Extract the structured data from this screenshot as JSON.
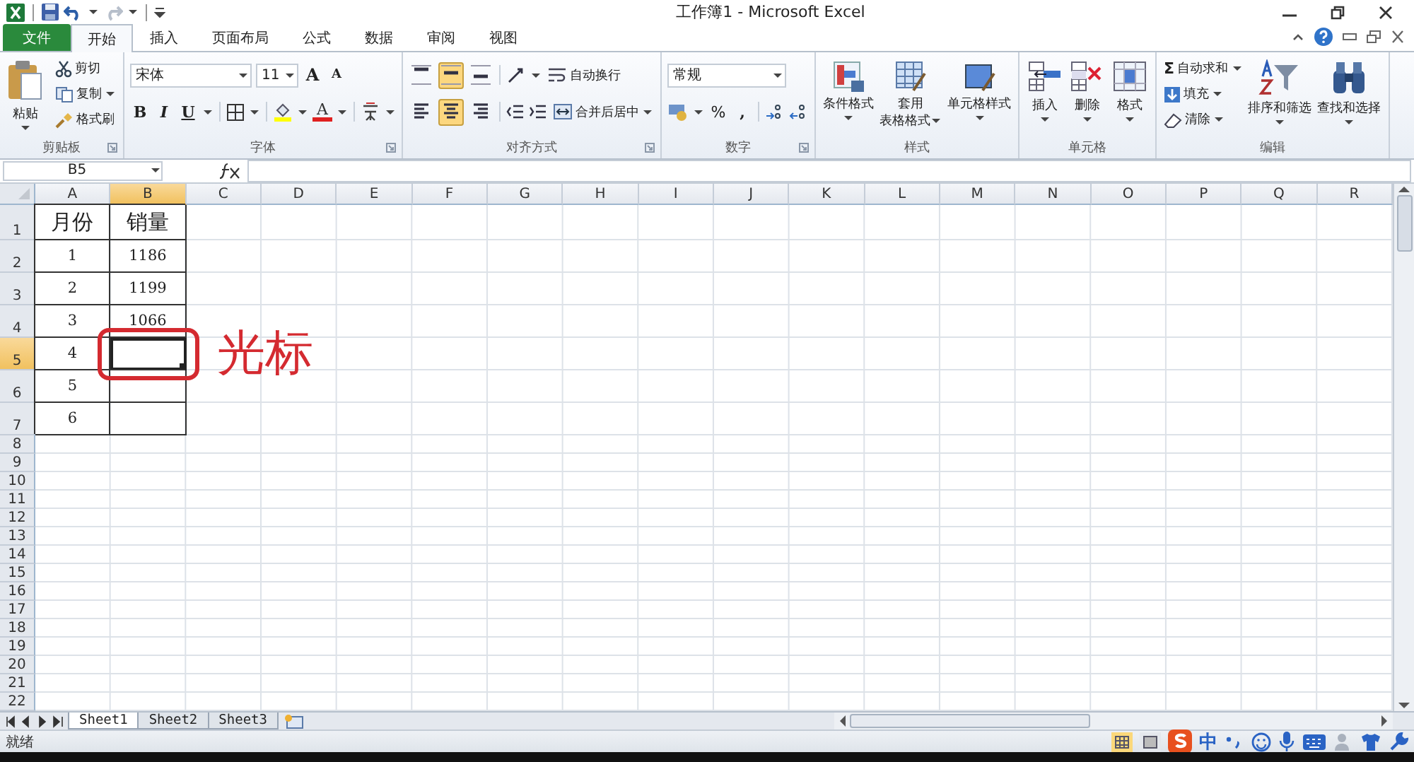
{
  "window": {
    "title": "工作簿1 - Microsoft Excel"
  },
  "ribbon_tabs": [
    {
      "label": "文件",
      "kind": "file",
      "selected": false
    },
    {
      "label": "开始",
      "kind": "tab",
      "selected": true
    },
    {
      "label": "插入",
      "kind": "tab",
      "selected": false
    },
    {
      "label": "页面布局",
      "kind": "tab",
      "selected": false
    },
    {
      "label": "公式",
      "kind": "tab",
      "selected": false
    },
    {
      "label": "数据",
      "kind": "tab",
      "selected": false
    },
    {
      "label": "审阅",
      "kind": "tab",
      "selected": false
    },
    {
      "label": "视图",
      "kind": "tab",
      "selected": false
    }
  ],
  "clipboard": {
    "title": "剪贴板",
    "paste": "粘贴",
    "cut": "剪切",
    "copy": "复制",
    "format_painter": "格式刷"
  },
  "font": {
    "title": "字体",
    "font_name": "宋体",
    "font_size": "11",
    "grow": "A",
    "shrink": "A",
    "bold": "B",
    "italic": "I",
    "underline": "U",
    "font_color": "A"
  },
  "alignment": {
    "title": "对齐方式",
    "vertical": [
      {
        "kind": "top",
        "selected": false
      },
      {
        "kind": "middle",
        "selected": true
      },
      {
        "kind": "bottom",
        "selected": false
      }
    ],
    "horizontal": [
      {
        "kind": "left",
        "selected": false
      },
      {
        "kind": "center",
        "selected": true
      },
      {
        "kind": "right",
        "selected": false
      }
    ],
    "wrap_text": "自动换行",
    "merge_center": "合并后居中"
  },
  "number": {
    "title": "数字",
    "format": "常规",
    "percent": "%",
    "comma": ","
  },
  "styles": {
    "title": "样式",
    "buttons": [
      {
        "kind": "conditional",
        "lines": [
          "条件格式"
        ]
      },
      {
        "kind": "table",
        "lines": [
          "套用",
          "表格格式"
        ]
      },
      {
        "kind": "cell",
        "lines": [
          "单元格样式"
        ]
      }
    ]
  },
  "cells": {
    "title": "单元格",
    "buttons": [
      {
        "kind": "insert",
        "label": "插入"
      },
      {
        "kind": "delete",
        "label": "删除"
      },
      {
        "kind": "format",
        "label": "格式"
      }
    ]
  },
  "editing": {
    "title": "编辑",
    "autosum_symbol": "Σ",
    "autosum": "自动求和",
    "fill": "填充",
    "clear": "清除",
    "sort_filter": "排序和筛选",
    "find_select": "查找和选择"
  },
  "formula_bar": {
    "name_box": "B5"
  },
  "grid": {
    "columns": [
      {
        "label": "A",
        "selected": false
      },
      {
        "label": "B",
        "selected": true
      },
      {
        "label": "C",
        "selected": false
      },
      {
        "label": "D",
        "selected": false
      },
      {
        "label": "E",
        "selected": false
      },
      {
        "label": "F",
        "selected": false
      },
      {
        "label": "G",
        "selected": false
      },
      {
        "label": "H",
        "selected": false
      },
      {
        "label": "I",
        "selected": false
      },
      {
        "label": "J",
        "selected": false
      },
      {
        "label": "K",
        "selected": false
      },
      {
        "label": "L",
        "selected": false
      },
      {
        "label": "M",
        "selected": false
      },
      {
        "label": "N",
        "selected": false
      },
      {
        "label": "O",
        "selected": false
      },
      {
        "label": "P",
        "selected": false
      },
      {
        "label": "Q",
        "selected": false
      },
      {
        "label": "R",
        "selected": false
      }
    ],
    "rows": [
      {
        "label": "1",
        "kind": "header",
        "selected": false,
        "cells": [
          {
            "text": "月份",
            "bordered": true
          },
          {
            "text": "销量",
            "bordered": true
          }
        ]
      },
      {
        "label": "2",
        "kind": "data",
        "selected": false,
        "cells": [
          {
            "text": "1",
            "bordered": true
          },
          {
            "text": "1186",
            "bordered": true
          }
        ]
      },
      {
        "label": "3",
        "kind": "data",
        "selected": false,
        "cells": [
          {
            "text": "2",
            "bordered": true
          },
          {
            "text": "1199",
            "bordered": true
          }
        ]
      },
      {
        "label": "4",
        "kind": "data",
        "selected": false,
        "cells": [
          {
            "text": "3",
            "bordered": true
          },
          {
            "text": "1066",
            "bordered": true
          }
        ]
      },
      {
        "label": "5",
        "kind": "data",
        "selected": true,
        "cells": [
          {
            "text": "4",
            "bordered": true
          },
          {
            "bordered": true
          }
        ]
      },
      {
        "label": "6",
        "kind": "data",
        "selected": false,
        "cells": [
          {
            "text": "5",
            "bordered": true
          },
          {
            "bordered": true
          }
        ]
      },
      {
        "label": "7",
        "kind": "data",
        "selected": false,
        "cells": [
          {
            "text": "6",
            "bordered": true
          },
          {
            "bordered": true
          }
        ]
      },
      {
        "label": "8",
        "kind": "plain",
        "selected": false
      },
      {
        "label": "9",
        "kind": "plain",
        "selected": false
      },
      {
        "label": "10",
        "kind": "plain",
        "selected": false
      },
      {
        "label": "11",
        "kind": "plain",
        "selected": false
      },
      {
        "label": "12",
        "kind": "plain",
        "selected": false
      },
      {
        "label": "13",
        "kind": "plain",
        "selected": false
      },
      {
        "label": "14",
        "kind": "plain",
        "selected": false
      },
      {
        "label": "15",
        "kind": "plain",
        "selected": false
      },
      {
        "label": "16",
        "kind": "plain",
        "selected": false
      },
      {
        "label": "17",
        "kind": "plain",
        "selected": false
      },
      {
        "label": "18",
        "kind": "plain",
        "selected": false
      },
      {
        "label": "19",
        "kind": "plain",
        "selected": false
      },
      {
        "label": "20",
        "kind": "plain",
        "selected": false
      },
      {
        "label": "21",
        "kind": "plain",
        "selected": false
      },
      {
        "label": "22",
        "kind": "plain",
        "selected": false
      }
    ]
  },
  "annotation": {
    "label": "光标"
  },
  "sheet_tabs": [
    {
      "label": "Sheet1",
      "selected": true
    },
    {
      "label": "Sheet2",
      "selected": false
    },
    {
      "label": "Sheet3",
      "selected": false
    }
  ],
  "status_bar": {
    "text": "就绪",
    "views": [
      {
        "kind": "normal",
        "selected": true
      },
      {
        "kind": "page_layout",
        "selected": false
      }
    ],
    "ime_language": "中"
  }
}
